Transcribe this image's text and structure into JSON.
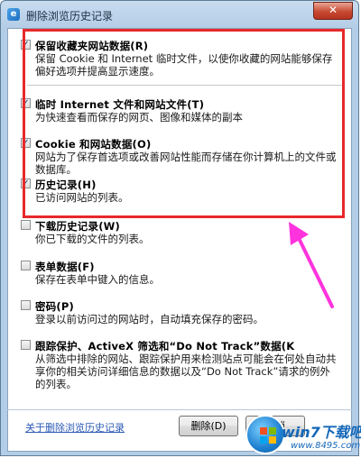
{
  "window": {
    "title": "删除浏览历史记录",
    "close_glyph": "✕"
  },
  "options": [
    {
      "title": "保留收藏夹网站数据(R)",
      "desc": "保留 Cookie 和 Internet 临时文件，以使你收藏的网站能够保存偏好选项并提高显示速度。",
      "checked": true
    },
    {
      "title": "临时 Internet 文件和网站文件(T)",
      "desc": "为快速查看而保存的网页、图像和媒体的副本",
      "checked": true
    },
    {
      "title": "Cookie 和网站数据(O)",
      "desc": "网站为了保存首选项或改善网站性能而存储在你计算机上的文件或数据库。",
      "checked": true
    },
    {
      "title": "历史记录(H)",
      "desc": "已访问网站的列表。",
      "checked": true
    },
    {
      "title": "下载历史记录(W)",
      "desc": "你已下载的文件的列表。",
      "checked": false
    },
    {
      "title": "表单数据(F)",
      "desc": "保存在表单中键入的信息。",
      "checked": false
    },
    {
      "title": "密码(P)",
      "desc": "登录以前访问过的网站时，自动填充保存的密码。",
      "checked": false
    },
    {
      "title": "跟踪保护、ActiveX 筛选和“Do Not Track”数据(K",
      "desc": "从筛选中排除的网站、跟踪保护用来检测站点可能会在何处自动共享你的相关访问详细信息的数据以及“Do Not Track”请求的例外的列表。",
      "checked": false
    }
  ],
  "check_glyph": "✓",
  "footer": {
    "link_label": "关于删除浏览历史记录",
    "delete_label": "删除(D)",
    "cancel_label": "取消"
  },
  "watermark": {
    "brand": "win7下载吧",
    "url": "www.8495.com"
  },
  "colors": {
    "highlight": "#e8282a",
    "arrow": "#ff33dd"
  }
}
